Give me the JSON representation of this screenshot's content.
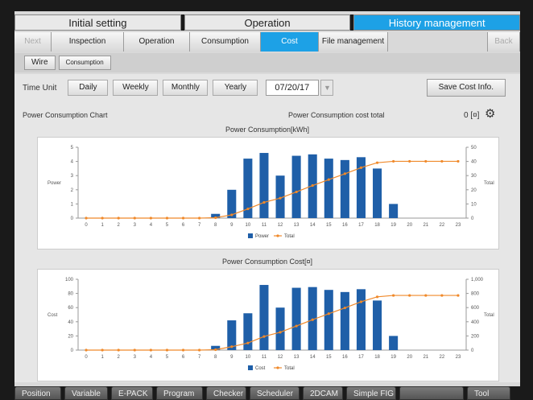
{
  "main_tabs": [
    {
      "label": "Initial setting",
      "active": false
    },
    {
      "label": "Operation",
      "active": false
    },
    {
      "label": "History management",
      "active": true
    }
  ],
  "sub_tabs": [
    {
      "label": "Next",
      "state": "disabled",
      "w": 46
    },
    {
      "label": "Inspection",
      "state": "",
      "w": 90
    },
    {
      "label": "Operation",
      "state": "",
      "w": 82
    },
    {
      "label": "Consumption",
      "state": "",
      "w": 88
    },
    {
      "label": "Cost",
      "state": "active",
      "w": 72
    },
    {
      "label": "File management",
      "state": "",
      "w": 86
    },
    {
      "label": "",
      "state": "spacer",
      "w": 124
    },
    {
      "label": "Back Next",
      "state": "disabled",
      "w": 40
    }
  ],
  "third_row": {
    "wire": "Wire",
    "consumption": "Consumption"
  },
  "time_unit": {
    "label": "Time Unit",
    "options": [
      {
        "label": "Daily",
        "active": true
      },
      {
        "label": "Weekly",
        "active": false
      },
      {
        "label": "Monthly",
        "active": false
      },
      {
        "label": "Yearly",
        "active": false
      }
    ],
    "date": "07/20/17",
    "save_label": "Save Cost Info."
  },
  "info": {
    "chart_caption": "Power Consumption Chart",
    "cost_total_label": "Power Consumption cost total",
    "cost_total_value": "0 [¤]"
  },
  "chart_data": [
    {
      "type": "bar",
      "title": "Power Consumption[kWh]",
      "ylabel": "Power",
      "y2label": "Total",
      "categories": [
        "0",
        "1",
        "2",
        "3",
        "4",
        "5",
        "6",
        "7",
        "8",
        "9",
        "10",
        "11",
        "12",
        "13",
        "14",
        "15",
        "16",
        "17",
        "18",
        "19",
        "20",
        "21",
        "22",
        "23"
      ],
      "series": [
        {
          "name": "Power",
          "kind": "bar",
          "color": "#1f5fa8",
          "values": [
            0,
            0,
            0,
            0,
            0,
            0,
            0,
            0,
            0.3,
            2.0,
            4.2,
            4.6,
            3.0,
            4.4,
            4.5,
            4.2,
            4.1,
            4.3,
            3.5,
            1.0,
            0,
            0,
            0,
            0
          ]
        },
        {
          "name": "Total",
          "kind": "line",
          "color": "#f0892a",
          "values": [
            0,
            0,
            0,
            0,
            0,
            0,
            0,
            0,
            0.3,
            2.3,
            6.5,
            11.1,
            14.1,
            18.5,
            23.0,
            27.2,
            31.3,
            35.6,
            39.1,
            40.1,
            40.1,
            40.1,
            40.1,
            40.1
          ]
        }
      ],
      "ylim": [
        0,
        5
      ],
      "yticks": [
        0,
        1,
        2,
        3,
        4,
        5
      ],
      "y2lim": [
        0,
        50
      ],
      "y2ticks": [
        0,
        10,
        20,
        30,
        40,
        50
      ]
    },
    {
      "type": "bar",
      "title": "Power Consumption Cost[¤]",
      "ylabel": "Cost",
      "y2label": "Total",
      "categories": [
        "0",
        "1",
        "2",
        "3",
        "4",
        "5",
        "6",
        "7",
        "8",
        "9",
        "10",
        "11",
        "12",
        "13",
        "14",
        "15",
        "16",
        "17",
        "18",
        "19",
        "20",
        "21",
        "22",
        "23"
      ],
      "series": [
        {
          "name": "Cost",
          "kind": "bar",
          "color": "#1f5fa8",
          "values": [
            0,
            0,
            0,
            0,
            0,
            0,
            0,
            0,
            6,
            42,
            52,
            92,
            60,
            88,
            89,
            85,
            82,
            86,
            70,
            20,
            0,
            0,
            0,
            0
          ]
        },
        {
          "name": "Total",
          "kind": "line",
          "color": "#f0892a",
          "values": [
            0,
            0,
            0,
            0,
            0,
            0,
            0,
            0,
            6,
            48,
            100,
            192,
            252,
            340,
            429,
            514,
            596,
            682,
            752,
            772,
            772,
            772,
            772,
            772
          ]
        }
      ],
      "ylim": [
        0,
        100
      ],
      "yticks": [
        0,
        20,
        40,
        60,
        80,
        100
      ],
      "y2lim": [
        0,
        1000
      ],
      "y2ticks": [
        "0",
        "200",
        "400",
        "600",
        "800",
        "1,000"
      ]
    }
  ],
  "bottom_bar": [
    "Position",
    "Variable",
    "E-PACK",
    "Program",
    "Checker",
    "Scheduler",
    "2DCAM",
    "Simple FIG",
    "",
    "Tool"
  ]
}
